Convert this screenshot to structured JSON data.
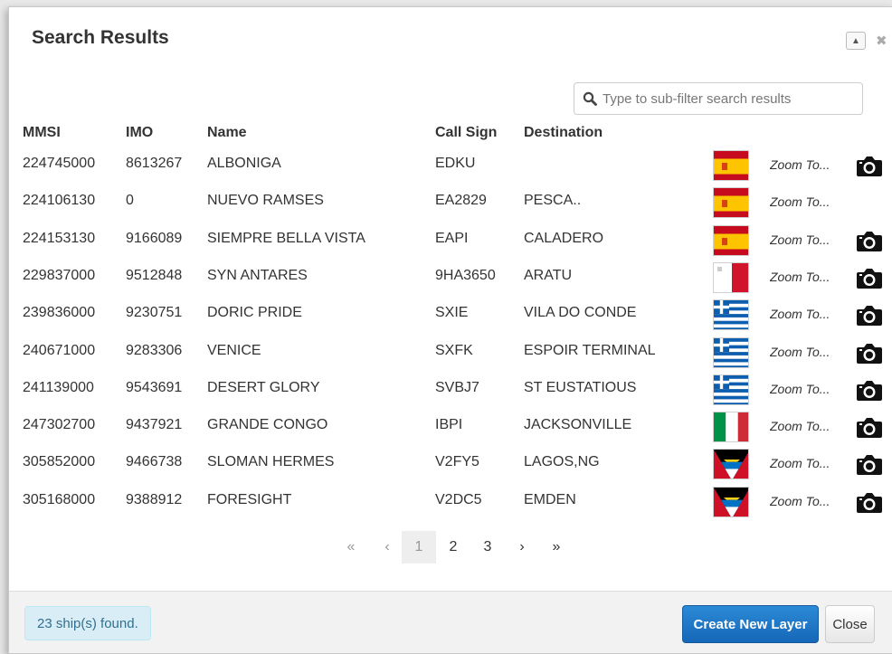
{
  "dialog": {
    "title": "Search Results",
    "collapse_icon": "chevron-up-icon",
    "close_icon": "close-icon"
  },
  "filter": {
    "placeholder": "Type to sub-filter search results",
    "icon": "search-icon"
  },
  "table": {
    "headers": [
      "MMSI",
      "IMO",
      "Name",
      "Call Sign",
      "Destination"
    ],
    "zoom_label": "Zoom To...",
    "rows": [
      {
        "mmsi": "224745000",
        "imo": "8613267",
        "name": "ALBONIGA",
        "call": "EDKU",
        "dest": "",
        "flag": "spain",
        "camera": true
      },
      {
        "mmsi": "224106130",
        "imo": "0",
        "name": "NUEVO RAMSES",
        "call": "EA2829",
        "dest": "PESCA..",
        "flag": "spain",
        "camera": false
      },
      {
        "mmsi": "224153130",
        "imo": "9166089",
        "name": "SIEMPRE BELLA VISTA",
        "call": "EAPI",
        "dest": "CALADERO",
        "flag": "spain",
        "camera": true
      },
      {
        "mmsi": "229837000",
        "imo": "9512848",
        "name": "SYN ANTARES",
        "call": "9HA3650",
        "dest": "ARATU",
        "flag": "malta",
        "camera": true
      },
      {
        "mmsi": "239836000",
        "imo": "9230751",
        "name": "DORIC PRIDE",
        "call": "SXIE",
        "dest": "VILA DO CONDE",
        "flag": "greece",
        "camera": true
      },
      {
        "mmsi": "240671000",
        "imo": "9283306",
        "name": "VENICE",
        "call": "SXFK",
        "dest": "ESPOIR TERMINAL",
        "flag": "greece",
        "camera": true
      },
      {
        "mmsi": "241139000",
        "imo": "9543691",
        "name": "DESERT GLORY",
        "call": "SVBJ7",
        "dest": "ST EUSTATIOUS",
        "flag": "greece",
        "camera": true
      },
      {
        "mmsi": "247302700",
        "imo": "9437921",
        "name": "GRANDE CONGO",
        "call": "IBPI",
        "dest": "JACKSONVILLE",
        "flag": "italy",
        "camera": true
      },
      {
        "mmsi": "305852000",
        "imo": "9466738",
        "name": "SLOMAN HERMES",
        "call": "V2FY5",
        "dest": "LAGOS,NG",
        "flag": "antigua",
        "camera": true
      },
      {
        "mmsi": "305168000",
        "imo": "9388912",
        "name": "FORESIGHT",
        "call": "V2DC5",
        "dest": "EMDEN",
        "flag": "antigua",
        "camera": true
      }
    ]
  },
  "pagination": {
    "first": "«",
    "prev": "‹",
    "pages": [
      "1",
      "2",
      "3"
    ],
    "active_page": "1",
    "next": "›",
    "last": "»"
  },
  "footer": {
    "status": "23 ship(s) found.",
    "create_label": "Create New Layer",
    "close_label": "Close"
  },
  "colors": {
    "primary": "#1a73c9",
    "status_bg": "#d9edf7",
    "status_text": "#31708f"
  }
}
